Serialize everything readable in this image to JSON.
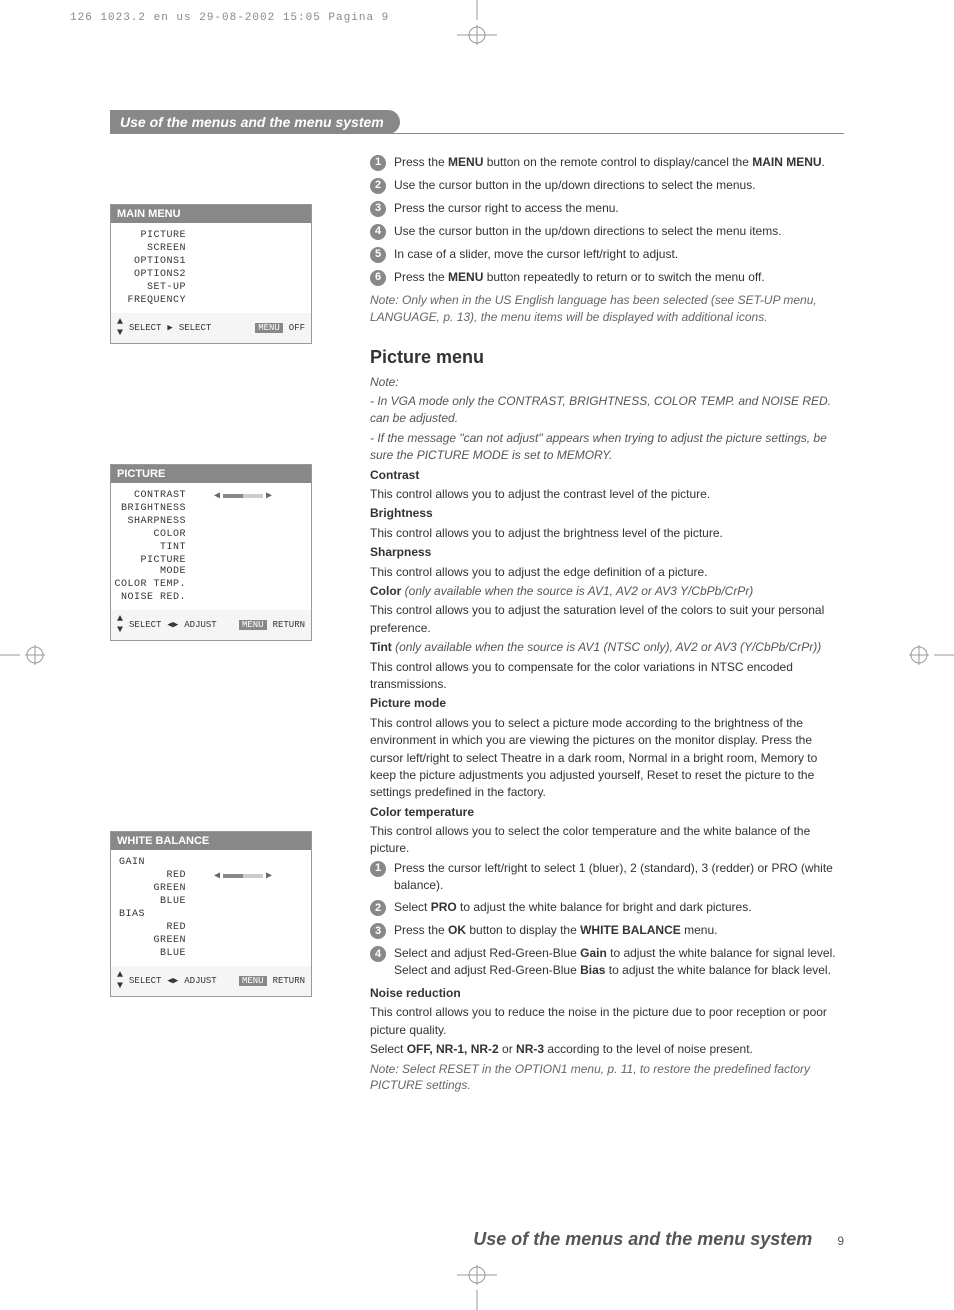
{
  "print_header": "126 1023.2 en us  29-08-2002  15:05  Pagina 9",
  "title": "Use of the menus and the menu system",
  "main_menu": {
    "header": "MAIN MENU",
    "items": [
      "PICTURE",
      "SCREEN",
      "OPTIONS1",
      "OPTIONS2",
      "SET-UP",
      "FREQUENCY"
    ],
    "footer": {
      "select1": "SELECT",
      "select2": "SELECT",
      "menu": "MENU",
      "off": "OFF"
    }
  },
  "picture_menu": {
    "header": "PICTURE",
    "items": [
      "CONTRAST",
      "BRIGHTNESS",
      "SHARPNESS",
      "COLOR",
      "TINT",
      "PICTURE MODE",
      "COLOR TEMP.",
      "NOISE RED."
    ],
    "footer": {
      "select": "SELECT",
      "adjust": "ADJUST",
      "menu": "MENU",
      "return": "RETURN"
    }
  },
  "wb_menu": {
    "header": "WHITE BALANCE",
    "gain": "GAIN",
    "bias": "BIAS",
    "rgb": [
      "RED",
      "GREEN",
      "BLUE"
    ],
    "footer": {
      "select": "SELECT",
      "adjust": "ADJUST",
      "menu": "MENU",
      "return": "RETURN"
    }
  },
  "steps": {
    "s1a": "Press the ",
    "s1b": "MENU",
    "s1c": " button on the remote control to display/cancel the ",
    "s1d": "MAIN MENU",
    "s1e": ".",
    "s2": "Use the cursor button in the up/down directions to select the menus.",
    "s3": "Press the cursor right to access the menu.",
    "s4": "Use the cursor button in the up/down directions to select the menu items.",
    "s5": "In case of a slider, move the cursor left/right to adjust.",
    "s6a": "Press the ",
    "s6b": "MENU",
    "s6c": " button repeatedly to return or to switch the menu off."
  },
  "note1": "Note: Only when in the US English language has been selected (see SET-UP menu, LANGUAGE, p. 13), the menu items will be displayed with additional icons.",
  "picture_section": {
    "title": "Picture menu",
    "note_label": "Note:",
    "note_a": "- In VGA mode only the CONTRAST, BRIGHTNESS, COLOR TEMP. and NOISE RED. can be adjusted.",
    "note_b": "- If the message \"can not adjust\" appears when trying to adjust the picture settings, be sure the PICTURE MODE is set to MEMORY.",
    "contrast_h": "Contrast",
    "contrast_t": "This control allows you to adjust the contrast level of the picture.",
    "brightness_h": "Brightness",
    "brightness_t": "This control allows you to adjust the brightness level of the picture.",
    "sharpness_h": "Sharpness",
    "sharpness_t": "This control allows you to adjust the edge definition of a picture.",
    "color_h": "Color",
    "color_note": " (only available when the source is AV1, AV2 or AV3 Y/CbPb/CrPr)",
    "color_t": "This control allows you to adjust the saturation level of the colors to suit your personal preference.",
    "tint_h": "Tint",
    "tint_note": " (only available when the source is AV1 (NTSC only), AV2 or AV3 (Y/CbPb/CrPr))",
    "tint_t": "This control allows you to compensate for the color variations in NTSC encoded transmissions.",
    "pmode_h": "Picture mode",
    "pmode_t": "This control allows you to select a picture mode according to the brightness of the environment in which you are viewing the pictures on the monitor display. Press the cursor left/right to select Theatre in a dark room, Normal in a bright room, Memory to keep the picture adjustments you adjusted yourself, Reset to reset the picture to the settings predefined in the factory.",
    "ctemp_h": "Color temperature",
    "ctemp_t": "This control allows you to select the color temperature and the white balance of the picture.",
    "ct1": "Press the cursor left/right to select 1 (bluer), 2 (standard), 3 (redder) or PRO (white balance).",
    "ct2a": "Select ",
    "ct2b": "PRO",
    "ct2c": " to adjust the white balance for bright and dark pictures.",
    "ct3a": "Press the ",
    "ct3b": "OK",
    "ct3c": " button to display the ",
    "ct3d": "WHITE BALANCE",
    "ct3e": " menu.",
    "ct4a": "Select and adjust Red-Green-Blue ",
    "ct4b": "Gain",
    "ct4c": " to adjust the white balance for signal level.",
    "ct4d": "Select and adjust Red-Green-Blue ",
    "ct4e": "Bias",
    "ct4f": " to adjust the white balance for black level.",
    "nr_h": "Noise reduction",
    "nr_t1": "This control allows you to reduce the noise in the picture due to poor reception or poor picture quality.",
    "nr_t2a": "Select ",
    "nr_t2b": "OFF, NR-1, NR-2",
    "nr_t2c": " or ",
    "nr_t2d": "NR-3",
    "nr_t2e": " according to the level of noise present.",
    "final_note": "Note: Select RESET in the OPTION1 menu, p. 11, to restore the predefined factory PICTURE settings."
  },
  "footer_title": "Use of the menus and the menu system",
  "page_num": "9"
}
